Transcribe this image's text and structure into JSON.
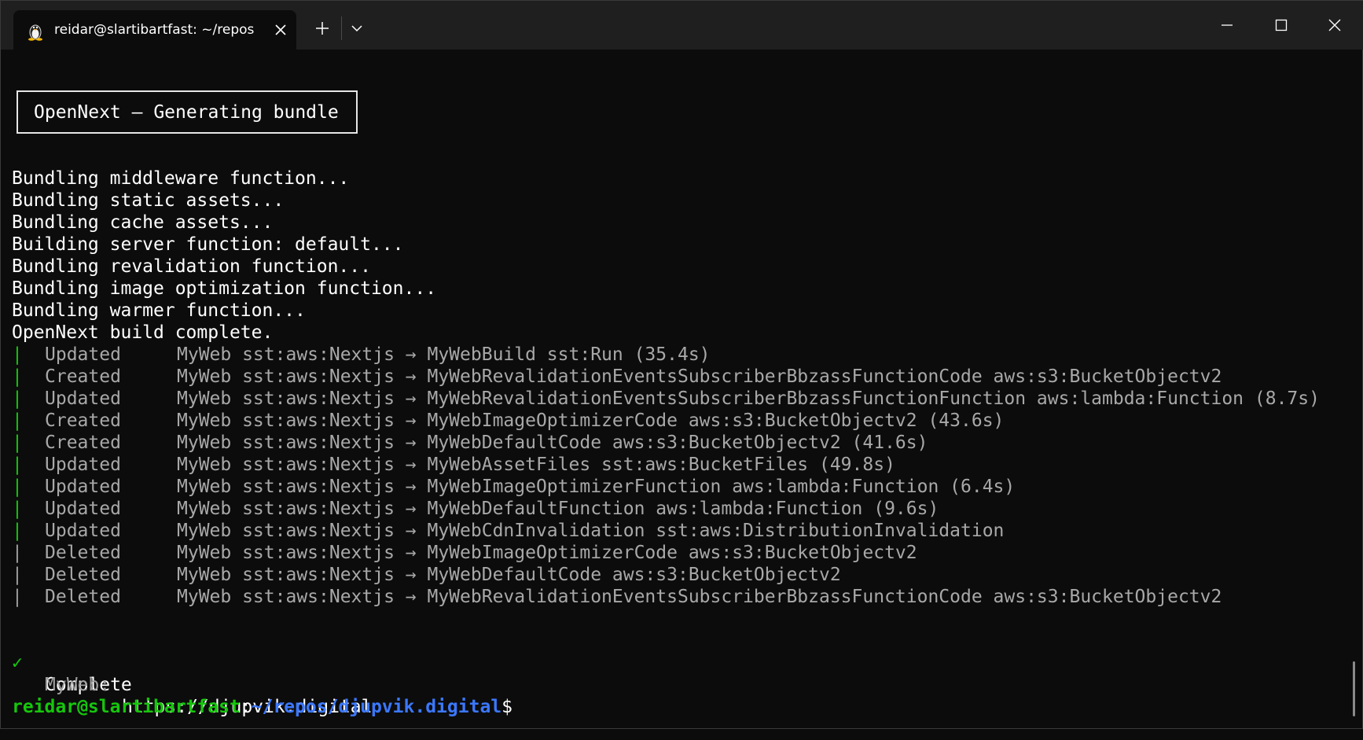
{
  "titlebar": {
    "tab_title": "reidar@slartibartfast: ~/repos",
    "tab_icon": "linux-tux-icon"
  },
  "terminal": {
    "banner": "OpenNext — Generating bundle",
    "log_lines": [
      "Bundling middleware function...",
      "Bundling static assets...",
      "Bundling cache assets...",
      "Building server function: default...",
      "Bundling revalidation function...",
      "Bundling image optimization function...",
      "Bundling warmer function...",
      "OpenNext build complete."
    ],
    "resources": [
      {
        "bar": "|",
        "color": "green",
        "action": "Updated",
        "desc": "MyWeb sst:aws:Nextjs → MyWebBuild sst:Run (35.4s)"
      },
      {
        "bar": "|",
        "color": "green",
        "action": "Created",
        "desc": "MyWeb sst:aws:Nextjs → MyWebRevalidationEventsSubscriberBbzassFunctionCode aws:s3:BucketObjectv2"
      },
      {
        "bar": "|",
        "color": "green",
        "action": "Updated",
        "desc": "MyWeb sst:aws:Nextjs → MyWebRevalidationEventsSubscriberBbzassFunctionFunction aws:lambda:Function (8.7s)"
      },
      {
        "bar": "|",
        "color": "green",
        "action": "Created",
        "desc": "MyWeb sst:aws:Nextjs → MyWebImageOptimizerCode aws:s3:BucketObjectv2 (43.6s)"
      },
      {
        "bar": "|",
        "color": "green",
        "action": "Created",
        "desc": "MyWeb sst:aws:Nextjs → MyWebDefaultCode aws:s3:BucketObjectv2 (41.6s)"
      },
      {
        "bar": "|",
        "color": "green",
        "action": "Updated",
        "desc": "MyWeb sst:aws:Nextjs → MyWebAssetFiles sst:aws:BucketFiles (49.8s)"
      },
      {
        "bar": "|",
        "color": "green",
        "action": "Updated",
        "desc": "MyWeb sst:aws:Nextjs → MyWebImageOptimizerFunction aws:lambda:Function (6.4s)"
      },
      {
        "bar": "|",
        "color": "green",
        "action": "Updated",
        "desc": "MyWeb sst:aws:Nextjs → MyWebDefaultFunction aws:lambda:Function (9.6s)"
      },
      {
        "bar": "|",
        "color": "green",
        "action": "Updated",
        "desc": "MyWeb sst:aws:Nextjs → MyWebCdnInvalidation sst:aws:DistributionInvalidation"
      },
      {
        "bar": "|",
        "color": "gray",
        "action": "Deleted",
        "desc": "MyWeb sst:aws:Nextjs → MyWebImageOptimizerCode aws:s3:BucketObjectv2"
      },
      {
        "bar": "|",
        "color": "gray",
        "action": "Deleted",
        "desc": "MyWeb sst:aws:Nextjs → MyWebDefaultCode aws:s3:BucketObjectv2"
      },
      {
        "bar": "|",
        "color": "gray",
        "action": "Deleted",
        "desc": "MyWeb sst:aws:Nextjs → MyWebRevalidationEventsSubscriberBbzassFunctionCode aws:s3:BucketObjectv2"
      }
    ],
    "complete": {
      "check": "✓",
      "label": "Complete",
      "url_label": "MyWeb:",
      "url": "https://djupvik.digital"
    },
    "prompt": {
      "user": "reidar@slartibartfast",
      "sep": ":",
      "path": "~/repos/djupvik.digital",
      "dollar": "$"
    }
  },
  "colors": {
    "background": "#0c0c0c",
    "titlebar": "#1f1f1f",
    "green": "#16c60c",
    "blue": "#3b78ff",
    "gray_text": "#a8a8a8"
  }
}
